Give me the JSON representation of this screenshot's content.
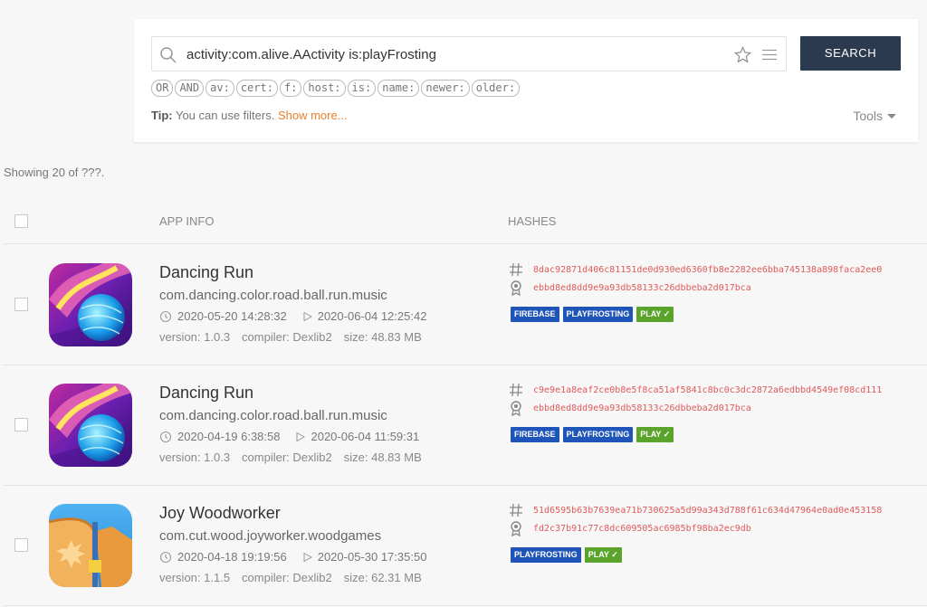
{
  "search": {
    "query": "activity:com.alive.AActivity is:playFrosting",
    "button_label": "SEARCH",
    "filters": [
      "OR",
      "AND",
      "av:",
      "cert:",
      "f:",
      "host:",
      "is:",
      "name:",
      "newer:",
      "older:"
    ],
    "tip_label": "Tip:",
    "tip_text": " You can use filters. ",
    "show_more": "Show more...",
    "tools_label": "Tools"
  },
  "results": {
    "showing_text": "Showing 20 of ???.",
    "headers": {
      "app_info": "APP INFO",
      "hashes": "HASHES"
    },
    "rows": [
      {
        "name": "Dancing Run",
        "package": "com.dancing.color.road.ball.run.music",
        "date_first": "2020-05-20 14:28:32",
        "date_second": "2020-06-04 12:25:42",
        "version": "version: 1.0.3",
        "compiler": "compiler: Dexlib2",
        "size": "size: 48.83 MB",
        "hash": "8dac92871d406c81151de0d930ed6360fb8e2282ee6bba745138a898faca2ee0",
        "cert": "ebbd8ed8dd9e9a93db58133c26dbbeba2d017bca",
        "tags": [
          "FIREBASE",
          "PLAYFROSTING"
        ],
        "play_label": "PLAY ✓",
        "icon": "dancing-run"
      },
      {
        "name": "Dancing Run",
        "package": "com.dancing.color.road.ball.run.music",
        "date_first": "2020-04-19 6:38:58",
        "date_second": "2020-06-04 11:59:31",
        "version": "version: 1.0.3",
        "compiler": "compiler: Dexlib2",
        "size": "size: 48.83 MB",
        "hash": "c9e9e1a8eaf2ce0b8e5f8ca51af5841c8bc0c3dc2872a6edbbd4549ef08cd111",
        "cert": "ebbd8ed8dd9e9a93db58133c26dbbeba2d017bca",
        "tags": [
          "FIREBASE",
          "PLAYFROSTING"
        ],
        "play_label": "PLAY ✓",
        "icon": "dancing-run"
      },
      {
        "name": "Joy Woodworker",
        "package": "com.cut.wood.joyworker.woodgames",
        "date_first": "2020-04-18 19:19:56",
        "date_second": "2020-05-30 17:35:50",
        "version": "version: 1.1.5",
        "compiler": "compiler: Dexlib2",
        "size": "size: 62.31 MB",
        "hash": "51d6595b63b7639ea71b730625a5d99a343d788f61c634d47964e0ad0e453158",
        "cert": "fd2c37b91c77c8dc609505ac6985bf98ba2ec9db",
        "tags": [
          "PLAYFROSTING"
        ],
        "play_label": "PLAY ✓",
        "icon": "joy-woodworker"
      }
    ]
  }
}
